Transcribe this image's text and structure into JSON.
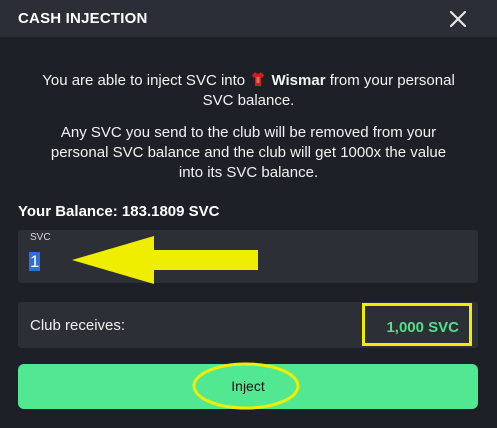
{
  "header": {
    "title": "CASH INJECTION",
    "close_icon": "close-icon"
  },
  "message": {
    "line1_before": "You are able to inject SVC into",
    "club_name": "Wismar",
    "line1_after": "from your personal",
    "line2": "SVC balance.",
    "paragraph2_line1": "Any SVC you send to the club will be removed from your",
    "paragraph2_line2": "personal SVC balance and the club will get 1000x the value",
    "paragraph2_line3": "into its SVC balance.",
    "club_icon": "red-jersey-icon"
  },
  "balance": {
    "text": "Your Balance: 183.1809 SVC"
  },
  "input": {
    "label": "SVC",
    "value": "1"
  },
  "club_receives": {
    "label": "Club receives:",
    "value": "1,000 SVC"
  },
  "inject_button": {
    "label": "Inject"
  },
  "colors": {
    "background": "#1d2027",
    "header": "#2b2e36",
    "field": "#2c2f36",
    "accent_green": "#52e891",
    "value_green": "#52e087",
    "annotation_yellow": "#f0ee00"
  }
}
